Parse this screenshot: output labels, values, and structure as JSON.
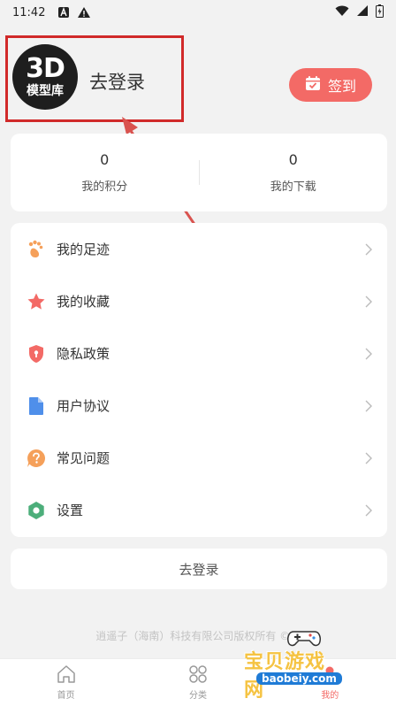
{
  "status_bar": {
    "time": "11:42"
  },
  "header": {
    "logo_line1": "3D",
    "logo_line2": "模型库",
    "login_label": "去登录",
    "signin_label": "签到"
  },
  "stats": [
    {
      "value": "0",
      "label": "我的积分"
    },
    {
      "value": "0",
      "label": "我的下载"
    }
  ],
  "menu": [
    {
      "label": "我的足迹",
      "icon": "footprint-icon",
      "color": "#f5a05a"
    },
    {
      "label": "我的收藏",
      "icon": "star-icon",
      "color": "#f36a66"
    },
    {
      "label": "隐私政策",
      "icon": "shield-icon",
      "color": "#f36a66"
    },
    {
      "label": "用户协议",
      "icon": "document-icon",
      "color": "#4f8fea"
    },
    {
      "label": "常见问题",
      "icon": "question-icon",
      "color": "#f5a05a"
    },
    {
      "label": "设置",
      "icon": "gear-icon",
      "color": "#4cae7a"
    }
  ],
  "logout_button": "去登录",
  "copyright": "逍遥子（海南）科技有限公司版权所有 © 2",
  "tabs": [
    {
      "label": "首页",
      "icon": "home-icon"
    },
    {
      "label": "分类",
      "icon": "grid-icon"
    },
    {
      "label": "我的",
      "icon": "profile-icon"
    }
  ],
  "watermark": {
    "text": "宝贝游戏网",
    "url": "baobeiy.com"
  },
  "colors": {
    "accent": "#f36a66",
    "annotation": "#d12a2a"
  }
}
